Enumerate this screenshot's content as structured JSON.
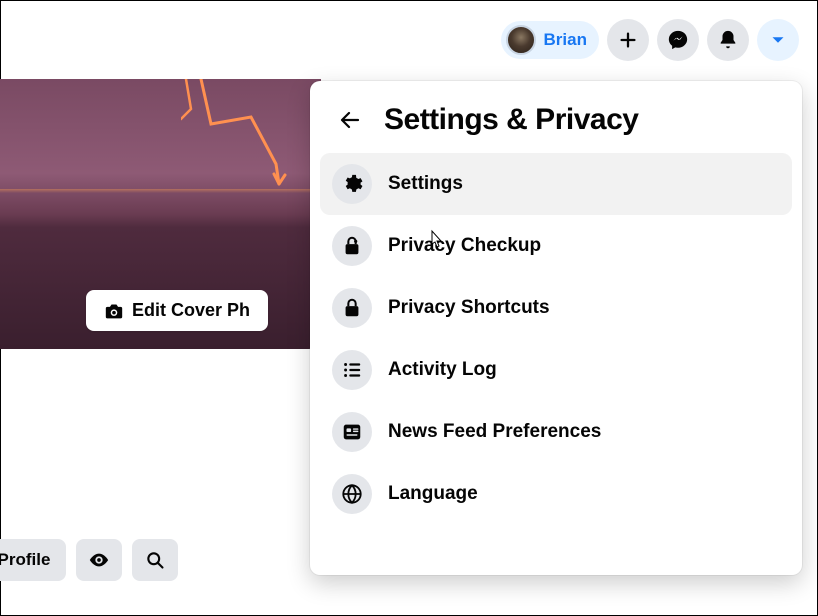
{
  "topbar": {
    "user_name": "Brian"
  },
  "cover": {
    "edit_label": "Edit Cover Ph"
  },
  "actions": {
    "edit_profile": "dit Profile"
  },
  "dropdown": {
    "title": "Settings & Privacy",
    "items": [
      {
        "label": "Settings"
      },
      {
        "label": "Privacy Checkup"
      },
      {
        "label": "Privacy Shortcuts"
      },
      {
        "label": "Activity Log"
      },
      {
        "label": "News Feed Preferences"
      },
      {
        "label": "Language"
      }
    ]
  }
}
